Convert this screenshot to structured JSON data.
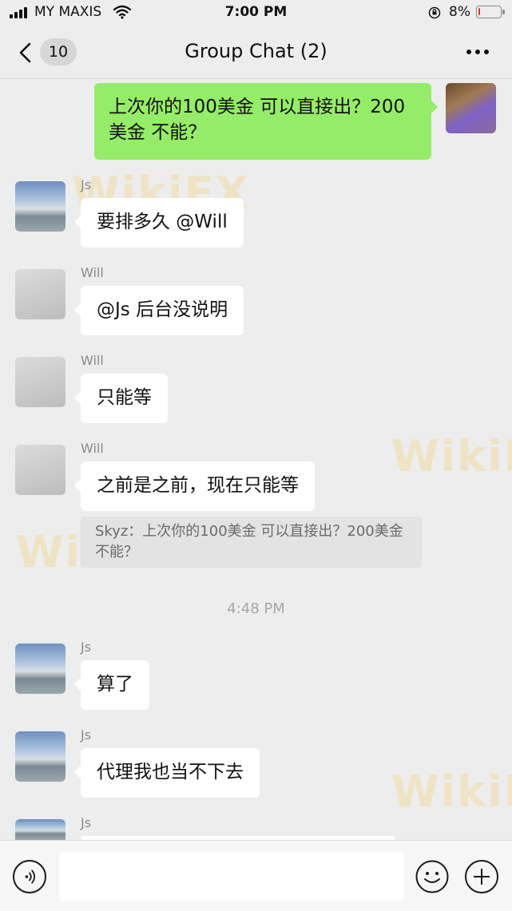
{
  "status_bar": {
    "carrier": "MY MAXIS",
    "time": "7:00 PM",
    "battery_percent": "8%",
    "battery_level": 0.08,
    "battery_color": "#e0332b"
  },
  "nav": {
    "unread_count": "10",
    "title": "Group Chat (2)"
  },
  "messages": [
    {
      "sender": "",
      "text": "上次你的100美金 可以直接出？200美金 不能？",
      "outgoing": true
    },
    {
      "sender": "Js",
      "text": "要排多久 @Will"
    },
    {
      "sender": "Will",
      "text": "@Js 后台没说明"
    },
    {
      "sender": "Will",
      "text": "只能等"
    },
    {
      "sender": "Will",
      "text": "之前是之前，现在只能等",
      "quote": "Skyz：上次你的100美金 可以直接出？200美金 不能？"
    },
    {
      "sender": "Js",
      "text": "算了"
    },
    {
      "sender": "Js",
      "text": "代理我也当不下去"
    },
    {
      "sender": "Js",
      "text": ""
    }
  ],
  "timestamp": "4:48 PM",
  "watermark": "WikiFX",
  "colors": {
    "outgoing_bubble": "#95ec69",
    "incoming_bubble": "#ffffff",
    "background": "#ededed"
  },
  "icons": {
    "back": "chevron-left-icon",
    "more": "ellipsis-icon",
    "voice": "voice-icon",
    "emoji": "emoji-icon",
    "plus": "plus-icon"
  }
}
